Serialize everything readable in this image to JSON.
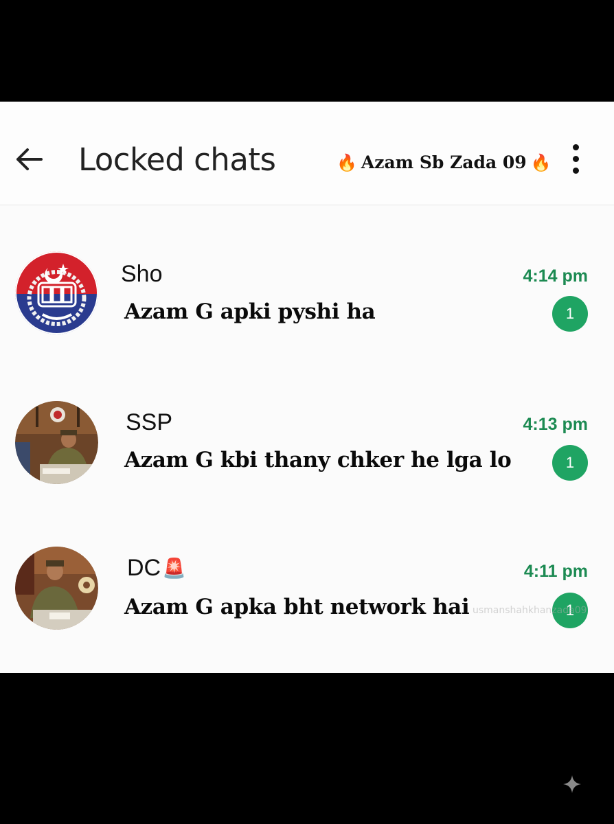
{
  "header": {
    "title": "Locked chats",
    "brand_text": "Azam Sb Zada 09",
    "brand_emoji": "🔥"
  },
  "chats": [
    {
      "name": "Sho",
      "message": "Azam G apki pyshi ha",
      "time": "4:14 pm",
      "unread": "1"
    },
    {
      "name": "SSP",
      "message": "Azam G kbi thany chker he lga lo",
      "time": "4:13 pm",
      "unread": "1"
    },
    {
      "name": "DC",
      "name_badge": "🚨",
      "message": "Azam G apka bht network hai",
      "time": "4:11 pm",
      "unread": "1"
    }
  ],
  "watermark": "usmanshahkhanzada09",
  "colors": {
    "accent": "#1fa463",
    "time": "#1c8a52",
    "background": "#000000",
    "panel": "#fbfbfb"
  }
}
